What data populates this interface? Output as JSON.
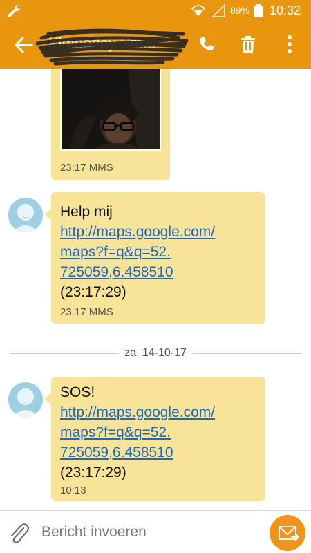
{
  "status_bar": {
    "battery_percent": "89%",
    "time": "10:32",
    "icons": [
      "wrench-icon",
      "wifi-icon",
      "signal-icon",
      "battery-icon"
    ]
  },
  "toolbar": {
    "contact_name": "Kimberley Sm...",
    "icons": [
      "back-arrow-icon",
      "phone-icon",
      "trash-icon",
      "more-vert-icon"
    ],
    "accent_color": "#e8960e"
  },
  "messages": [
    {
      "type": "mms",
      "time": "23:17 MMS"
    },
    {
      "type": "sms",
      "text": "Help mij",
      "link_lines": [
        "http://maps.google.com/",
        "maps?f=q&q=52.",
        "725059,6.458510"
      ],
      "suffix": "(23:17:29)",
      "time": "23:17 MMS"
    },
    {
      "type": "sms",
      "text": "SOS!",
      "link_lines": [
        "http://maps.google.com/",
        "maps?f=q&q=52.",
        "725059,6.458510"
      ],
      "suffix": "(23:17:29)",
      "time": "10:13"
    }
  ],
  "date_separator": "za, 14-10-17",
  "compose": {
    "placeholder": "Bericht invoeren",
    "icons": [
      "paperclip-icon",
      "send-icon"
    ]
  },
  "colors": {
    "bubble": "#f8e498",
    "link": "#1d69c6",
    "send_button": "#f2941c"
  }
}
